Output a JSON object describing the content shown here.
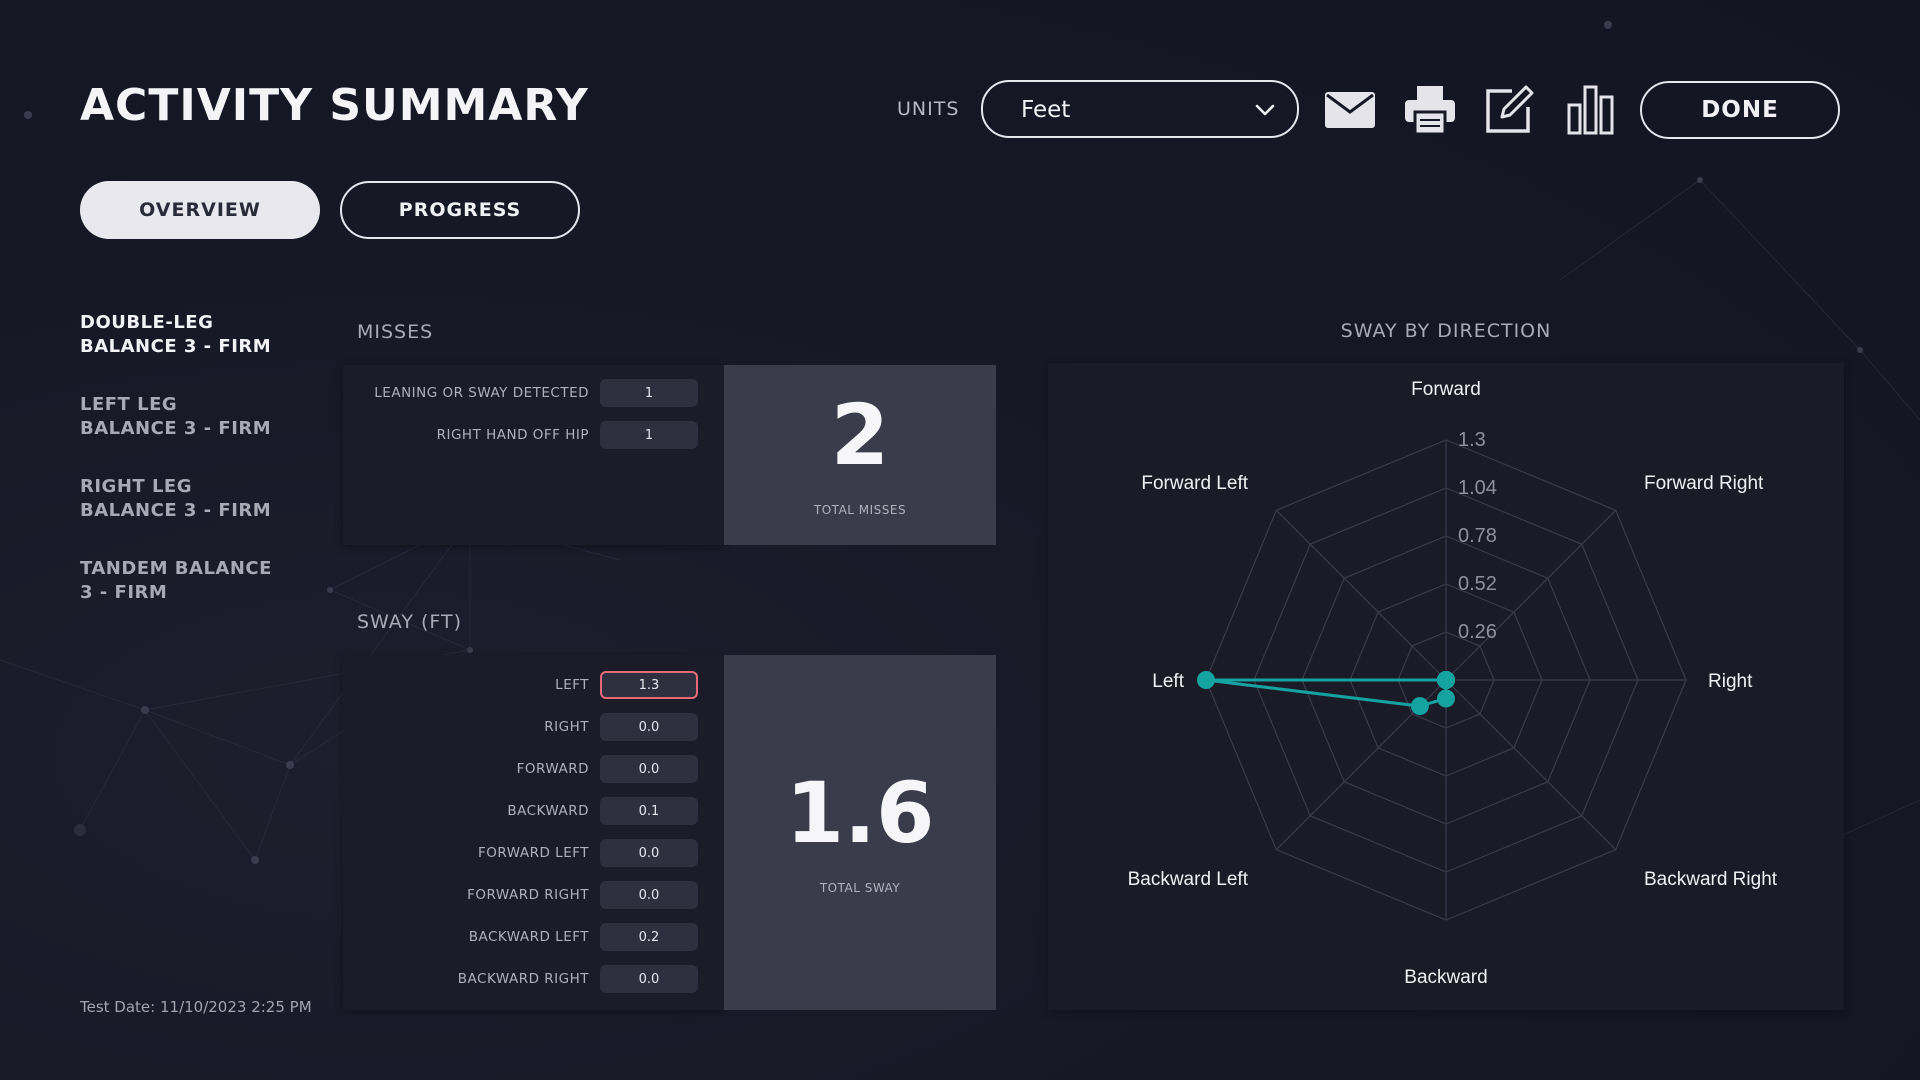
{
  "header": {
    "title": "ACTIVITY SUMMARY",
    "units_label": "UNITS",
    "units_value": "Feet",
    "done_label": "DONE"
  },
  "icons": [
    "mail-icon",
    "printer-icon",
    "edit-icon",
    "bar-chart-icon",
    "chevron-down-icon"
  ],
  "tabs": [
    {
      "label": "OVERVIEW",
      "selected": true
    },
    {
      "label": "PROGRESS",
      "selected": false
    }
  ],
  "tests": [
    {
      "line1": "DOUBLE-LEG",
      "line2": "BALANCE 3 - FIRM",
      "active": true
    },
    {
      "line1": "LEFT LEG",
      "line2": "BALANCE 3 - FIRM",
      "active": false
    },
    {
      "line1": "RIGHT LEG",
      "line2": "BALANCE 3 - FIRM",
      "active": false
    },
    {
      "line1": "TANDEM BALANCE",
      "line2": "3 - FIRM",
      "active": false
    }
  ],
  "test_date": "Test Date: 11/10/2023 2:25 PM",
  "misses": {
    "label": "MISSES",
    "rows": [
      {
        "label": "LEANING OR SWAY DETECTED",
        "value": "1"
      },
      {
        "label": "RIGHT HAND OFF HIP",
        "value": "1"
      }
    ],
    "total": "2",
    "total_label": "TOTAL MISSES"
  },
  "sway": {
    "label": "SWAY (FT)",
    "rows": [
      {
        "label": "LEFT",
        "value": "1.3",
        "highlight": true
      },
      {
        "label": "RIGHT",
        "value": "0.0"
      },
      {
        "label": "FORWARD",
        "value": "0.0"
      },
      {
        "label": "BACKWARD",
        "value": "0.1"
      },
      {
        "label": "FORWARD LEFT",
        "value": "0.0"
      },
      {
        "label": "FORWARD RIGHT",
        "value": "0.0"
      },
      {
        "label": "BACKWARD LEFT",
        "value": "0.2"
      },
      {
        "label": "BACKWARD RIGHT",
        "value": "0.0"
      }
    ],
    "total": "1.6",
    "total_label": "TOTAL SWAY"
  },
  "radar": {
    "title": "SWAY BY DIRECTION",
    "accent": "#14a3a0"
  },
  "chart_data": {
    "type": "radar",
    "title": "SWAY BY DIRECTION",
    "axes": [
      "Forward",
      "Forward Right",
      "Right",
      "Backward Right",
      "Backward",
      "Backward Left",
      "Left",
      "Forward Left"
    ],
    "ticks": [
      "0.26",
      "0.52",
      "0.78",
      "1.04",
      "1.3"
    ],
    "range": [
      0,
      1.3
    ],
    "series": [
      {
        "values": [
          0.0,
          0.0,
          0.0,
          0.0,
          0.1,
          0.2,
          1.3,
          0.0
        ],
        "color": "#14a3a0"
      }
    ],
    "grid": true
  }
}
